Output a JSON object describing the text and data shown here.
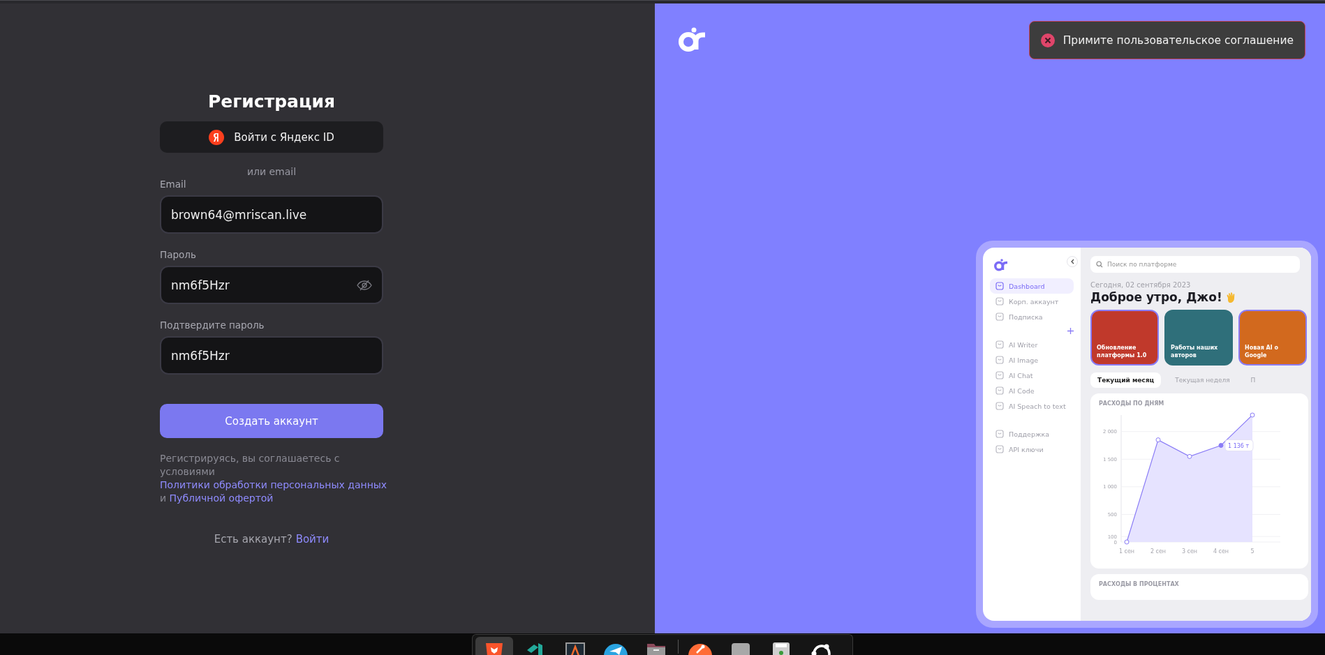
{
  "form": {
    "title": "Регистрация",
    "yandex_button": "Войти с Яндекс ID",
    "divider": "или email",
    "fields": [
      {
        "kind": "email",
        "label": "Email",
        "value": "brown64@mriscan.live"
      },
      {
        "kind": "password",
        "label": "Пароль",
        "value": "nm6f5Hzr"
      },
      {
        "kind": "text",
        "label": "Подтвердите пароль",
        "value": "nm6f5Hzr"
      }
    ],
    "submit_button": "Создать аккаунт",
    "terms": [
      {
        "text": "Регистрируясь, вы соглашаетесь с условиями ",
        "link": false
      },
      {
        "text": "Политики обработки персональных данных",
        "link": true
      },
      {
        "text": " и ",
        "link": false
      },
      {
        "text": "Публичной офертой",
        "link": true
      }
    ],
    "login_prompt": "Есть аккаунт?",
    "login_link": "Войти"
  },
  "toast": {
    "kind": "error",
    "text": "Примите пользовательское соглашение"
  },
  "preview": {
    "search_placeholder": "Поиск по платформе",
    "date": "Сегодня, 02 сентября 2023",
    "greeting": "Доброе утро, Джо!",
    "sidebar": [
      {
        "items": [
          {
            "label": "Dashboard",
            "selected": true
          },
          {
            "label": "Корп. аккаунт",
            "selected": false
          },
          {
            "label": "Подписка",
            "selected": false
          }
        ]
      },
      {
        "items": [
          {
            "label": "AI Writer",
            "selected": false
          },
          {
            "label": "AI Image",
            "selected": false
          },
          {
            "label": "AI Chat",
            "selected": false
          },
          {
            "label": "AI Code",
            "selected": false
          },
          {
            "label": "AI Speach to text",
            "selected": false
          }
        ]
      },
      {
        "items": [
          {
            "label": "Поддержка",
            "selected": false
          },
          {
            "label": "API ключи",
            "selected": false
          }
        ]
      }
    ],
    "cards": [
      {
        "text": "Обновление платформы 1.0",
        "selected": true,
        "color": "#c0392b"
      },
      {
        "text": "Работы наших авторов",
        "selected": false,
        "color": "#2f6f7a"
      },
      {
        "text": "Новая AI о Google",
        "selected": true,
        "color": "#d2691e"
      }
    ],
    "tabs": [
      {
        "label": "Текущий месяц",
        "selected": true
      },
      {
        "label": "Текущая неделя",
        "selected": false
      },
      {
        "label": "П",
        "selected": false
      }
    ],
    "chart_title": "РАСХОДЫ ПО ДНЯМ",
    "chart_data": {
      "type": "area",
      "grid": true,
      "marker": true,
      "categories": [
        "1 сен",
        "2 сен",
        "3 сен",
        "4 сен",
        "5"
      ],
      "values": [
        0,
        1850,
        1550,
        1750,
        2300
      ],
      "ylim": [
        0,
        2300
      ],
      "yticks": [
        {
          "value": 0,
          "label": "0"
        },
        {
          "value": 100,
          "label": "100"
        },
        {
          "value": 500,
          "label": "500"
        },
        {
          "value": 1000,
          "label": "1 000"
        },
        {
          "value": 1500,
          "label": "1 500"
        },
        {
          "value": 2000,
          "label": "2 000"
        }
      ],
      "annotations": [
        {
          "x": "4 сен",
          "y": 1750,
          "text": "1 136 т"
        }
      ]
    },
    "second_card_title": "РАСХОДЫ В ПРОЦЕНТАХ"
  },
  "dock": [
    {
      "kind": "browser",
      "selected": true
    },
    {
      "kind": "editor",
      "selected": false
    },
    {
      "kind": "ide",
      "selected": false
    },
    {
      "kind": "messenger",
      "selected": false
    },
    {
      "kind": "files",
      "selected": false
    },
    {
      "kind": "api",
      "selected": false
    },
    {
      "kind": "blank",
      "selected": false
    },
    {
      "kind": "archive",
      "selected": false
    },
    {
      "kind": "ubuntu",
      "selected": false
    }
  ]
}
